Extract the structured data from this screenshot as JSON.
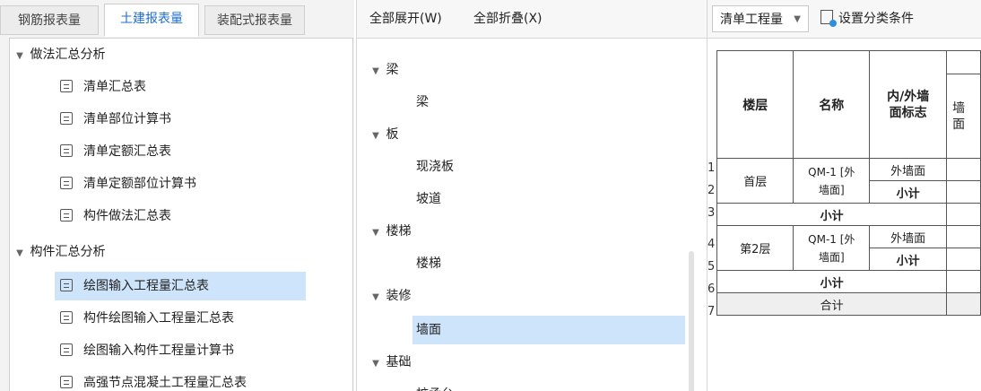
{
  "left_tabs": [
    {
      "label": "钢筋报表量"
    },
    {
      "label": "土建报表量"
    },
    {
      "label": "装配式报表量"
    }
  ],
  "left_tree": {
    "group1": {
      "label": "做法汇总分析",
      "items": [
        {
          "label": "清单汇总表"
        },
        {
          "label": "清单部位计算书"
        },
        {
          "label": "清单定额汇总表"
        },
        {
          "label": "清单定额部位计算书"
        },
        {
          "label": "构件做法汇总表"
        }
      ]
    },
    "group2": {
      "label": "构件汇总分析",
      "items": [
        {
          "label": "绘图输入工程量汇总表"
        },
        {
          "label": "构件绘图输入工程量汇总表"
        },
        {
          "label": "绘图输入构件工程量计算书"
        },
        {
          "label": "高强节点混凝土工程量汇总表"
        }
      ]
    }
  },
  "mid_toolbar": {
    "expand_all": "全部展开(W)",
    "collapse_all": "全部折叠(X)"
  },
  "mid_tree": [
    {
      "label": "梁",
      "children": [
        {
          "label": "梁"
        }
      ]
    },
    {
      "label": "板",
      "children": [
        {
          "label": "现浇板"
        },
        {
          "label": "坡道"
        }
      ]
    },
    {
      "label": "楼梯",
      "children": [
        {
          "label": "楼梯"
        }
      ]
    },
    {
      "label": "装修",
      "children": [
        {
          "label": "墙面"
        }
      ]
    },
    {
      "label": "基础",
      "children": [
        {
          "label": "桩承台"
        }
      ]
    }
  ],
  "right_toolbar": {
    "dropdown_value": "清单工程量",
    "set_condition": "设置分类条件"
  },
  "report": {
    "headers": {
      "floor": "楼层",
      "name": "名称",
      "wall_flag_1": "内/外墙",
      "wall_flag_2": "面标志",
      "extra_1": "墙",
      "extra_2": "面"
    },
    "row_numbers": [
      "1",
      "2",
      "3",
      "4",
      "5",
      "6",
      "7"
    ],
    "rows": {
      "r1_floor": "首层",
      "r1_name_1": "QM-1 [外",
      "r1_name_2": "墙面]",
      "r1_flag": "外墙面",
      "r1_sub": "小计",
      "r1_total": "小计",
      "r2_floor": "第2层",
      "r2_name_1": "QM-1 [外",
      "r2_name_2": "墙面]",
      "r2_flag": "外墙面",
      "r2_sub": "小计",
      "r2_total": "小计",
      "grand_total": "合计"
    }
  }
}
